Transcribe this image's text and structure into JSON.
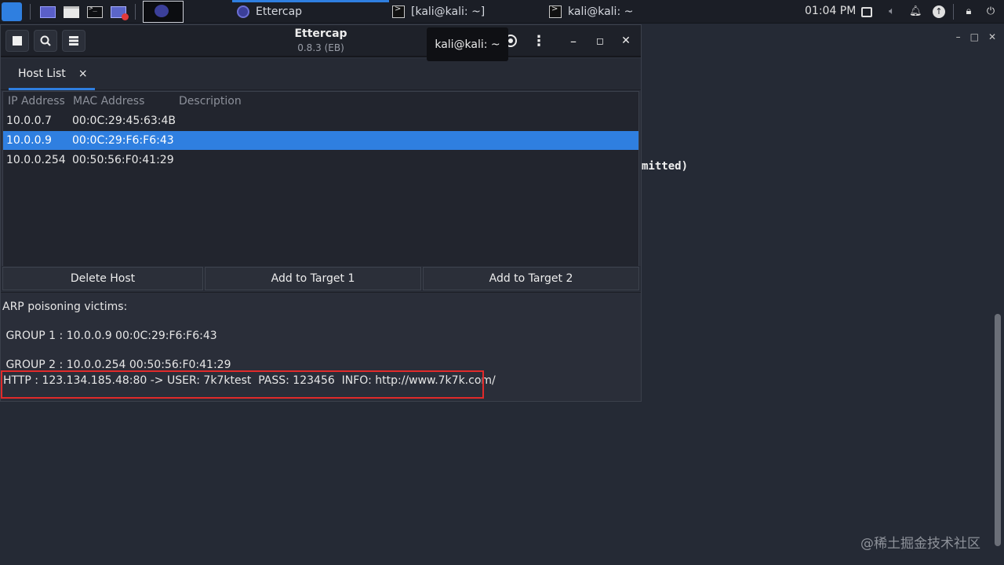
{
  "panel": {
    "taskbar": [
      {
        "label": "Ettercap",
        "icon": "ettercap-icon",
        "active": true
      },
      {
        "label": "[kali@kali: ~]",
        "icon": "terminal-icon"
      },
      {
        "label": "kali@kali: ~",
        "icon": "terminal-icon"
      }
    ],
    "clock": "01:04 PM"
  },
  "window": {
    "title": "Ettercap",
    "subtitle": "0.8.3 (EB)",
    "tooltip": "kali@kali: ~",
    "tab": {
      "label": "Host List",
      "close": "×"
    },
    "columns": [
      "IP Address",
      "MAC Address",
      "Description"
    ],
    "hosts": [
      {
        "ip": "10.0.0.7",
        "mac": "00:0C:29:45:63:4B",
        "description": ""
      },
      {
        "ip": "10.0.0.9",
        "mac": "00:0C:29:F6:F6:43",
        "description": "",
        "selected": true
      },
      {
        "ip": "10.0.0.254",
        "mac": "00:50:56:F0:41:29",
        "description": ""
      }
    ],
    "buttons": {
      "delete_host": "Delete Host",
      "add_target_1": "Add to Target 1",
      "add_target_2": "Add to Target 2"
    },
    "log": {
      "line1": "ARP poisoning victims:",
      "line2": " GROUP 1 : 10.0.0.9 00:0C:29:F6:F6:43",
      "line3": " GROUP 2 : 10.0.0.254 00:50:56:F0:41:29",
      "line4": "HTTP : 123.134.185.48:80 -> USER: 7k7ktest  PASS: 123456  INFO: http://www.7k7k.com/"
    }
  },
  "background_terminal": {
    "visible_text": "mitted)"
  },
  "watermark": "@稀土掘金技术社区",
  "colors": {
    "accent": "#2f7fe0",
    "highlight_box": "#e02a2a",
    "window_bg": "#2a2e39",
    "desktop_bg": "#252a35"
  }
}
